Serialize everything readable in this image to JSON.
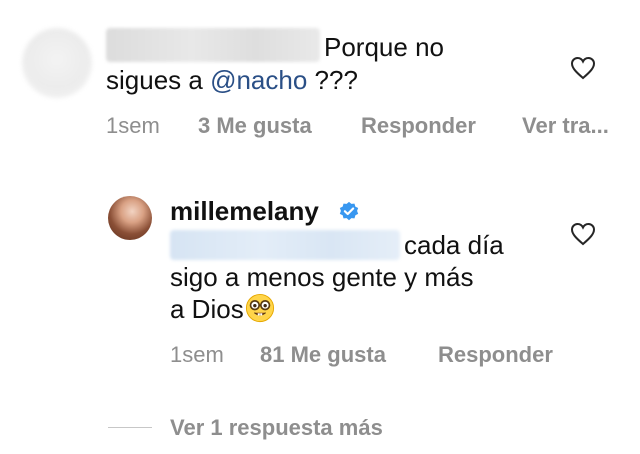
{
  "comment1": {
    "text_line1": "Porque no",
    "text_line2_prefix": "sigues a ",
    "mention": "@nacho",
    "text_line2_suffix": " ???",
    "time": "1sem",
    "likes": "3 Me gusta",
    "reply": "Responder",
    "translate": "Ver tra..."
  },
  "comment2": {
    "username": "millemelany",
    "text_line1": "cada día",
    "text_line2": "sigo a menos gente y más",
    "text_line3": "a Dios",
    "emoji": "nerd-face",
    "time": "1sem",
    "likes": "81 Me gusta",
    "reply": "Responder"
  },
  "more_replies": "Ver 1 respuesta más",
  "colors": {
    "mention": "#2a4f86",
    "meta": "#8e8e8e",
    "verified": "#3897f0"
  }
}
